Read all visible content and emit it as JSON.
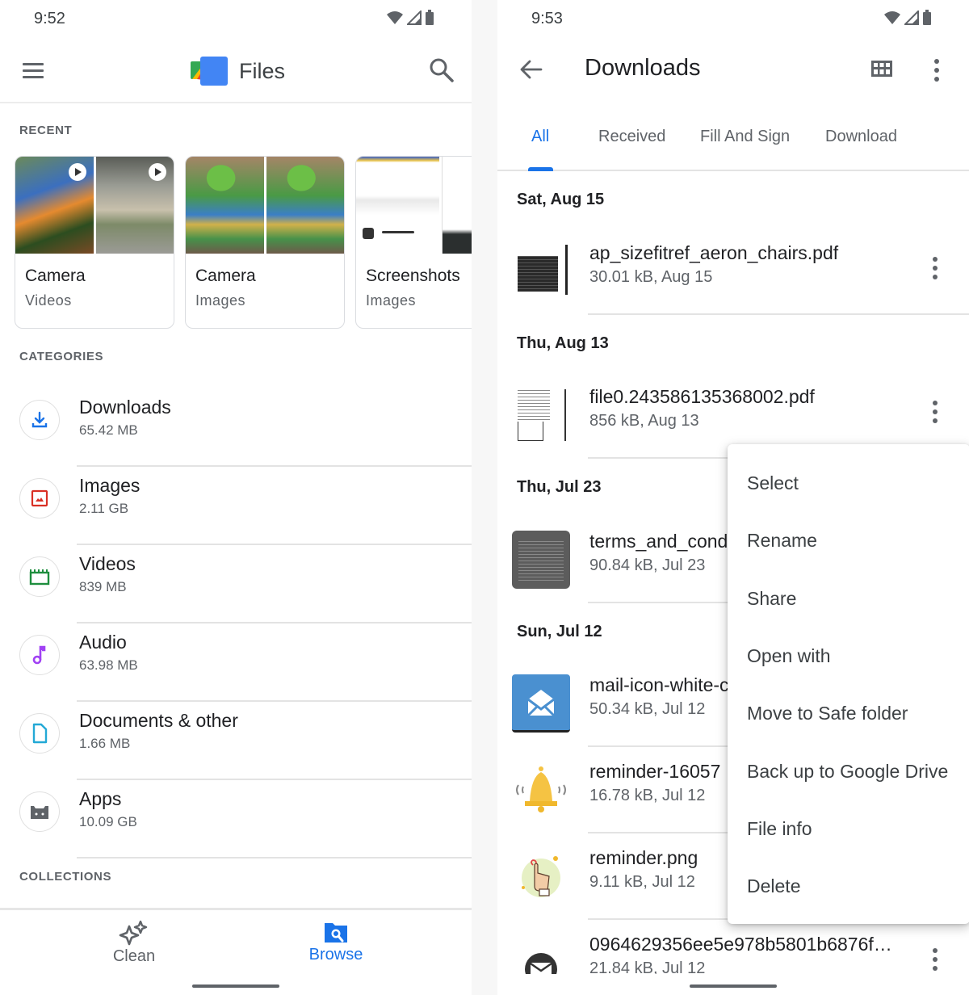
{
  "left_screen": {
    "status": {
      "time": "9:52"
    },
    "app_bar": {
      "title": "Files"
    },
    "recent": {
      "label": "RECENT",
      "cards": [
        {
          "title": "Camera",
          "subtitle": "Videos"
        },
        {
          "title": "Camera",
          "subtitle": "Images"
        },
        {
          "title": "Screenshots",
          "subtitle": "Images"
        }
      ]
    },
    "categories": {
      "label": "CATEGORIES",
      "items": [
        {
          "title": "Downloads",
          "size": "65.42 MB",
          "icon": "download-icon",
          "color": "#1a73e8"
        },
        {
          "title": "Images",
          "size": "2.11 GB",
          "icon": "image-icon",
          "color": "#d93025"
        },
        {
          "title": "Videos",
          "size": "839 MB",
          "icon": "video-icon",
          "color": "#1e8e3e"
        },
        {
          "title": "Audio",
          "size": "63.98 MB",
          "icon": "music-note-icon",
          "color": "#a142f4"
        },
        {
          "title": "Documents & other",
          "size": "1.66 MB",
          "icon": "document-icon",
          "color": "#24a9d6"
        },
        {
          "title": "Apps",
          "size": "10.09 GB",
          "icon": "android-icon",
          "color": "#5f6368"
        }
      ]
    },
    "collections": {
      "label": "COLLECTIONS"
    },
    "bottom_nav": {
      "items": [
        {
          "label": "Clean",
          "icon": "sparkle-icon",
          "active": false
        },
        {
          "label": "Browse",
          "icon": "folder-search-icon",
          "active": true
        }
      ]
    }
  },
  "right_screen": {
    "status": {
      "time": "9:53"
    },
    "app_bar": {
      "title": "Downloads"
    },
    "tabs": [
      {
        "label": "All",
        "active": true
      },
      {
        "label": "Received",
        "active": false
      },
      {
        "label": "Fill And Sign",
        "active": false
      },
      {
        "label": "Download",
        "active": false
      }
    ],
    "groups": [
      {
        "date": "Sat, Aug 15",
        "files": [
          {
            "name": "ap_sizefitref_aeron_chairs.pdf",
            "meta": "30.01 kB, Aug 15"
          }
        ]
      },
      {
        "date": "Thu, Aug 13",
        "files": [
          {
            "name": "file0.243586135368002.pdf",
            "meta": "856 kB, Aug 13"
          }
        ]
      },
      {
        "date": "Thu, Jul 23",
        "files": [
          {
            "name": "terms_and_cond",
            "meta": "90.84 kB, Jul 23"
          }
        ]
      },
      {
        "date": "Sun, Jul 12",
        "files": [
          {
            "name": "mail-icon-white-c",
            "meta": "50.34 kB, Jul 12"
          },
          {
            "name": "reminder-16057",
            "meta": "16.78 kB, Jul 12"
          },
          {
            "name": "reminder.png",
            "meta": "9.11 kB, Jul 12"
          },
          {
            "name": "0964629356ee5e978b5801b6876f…",
            "meta": "21.84 kB, Jul 12"
          }
        ]
      }
    ],
    "context_menu": {
      "items": [
        "Select",
        "Rename",
        "Share",
        "Open with",
        "Move to Safe folder",
        "Back up to Google Drive",
        "File info",
        "Delete"
      ]
    }
  },
  "colors": {
    "accent": "#1a73e8",
    "text_primary": "#202124",
    "text_secondary": "#5f6368"
  }
}
